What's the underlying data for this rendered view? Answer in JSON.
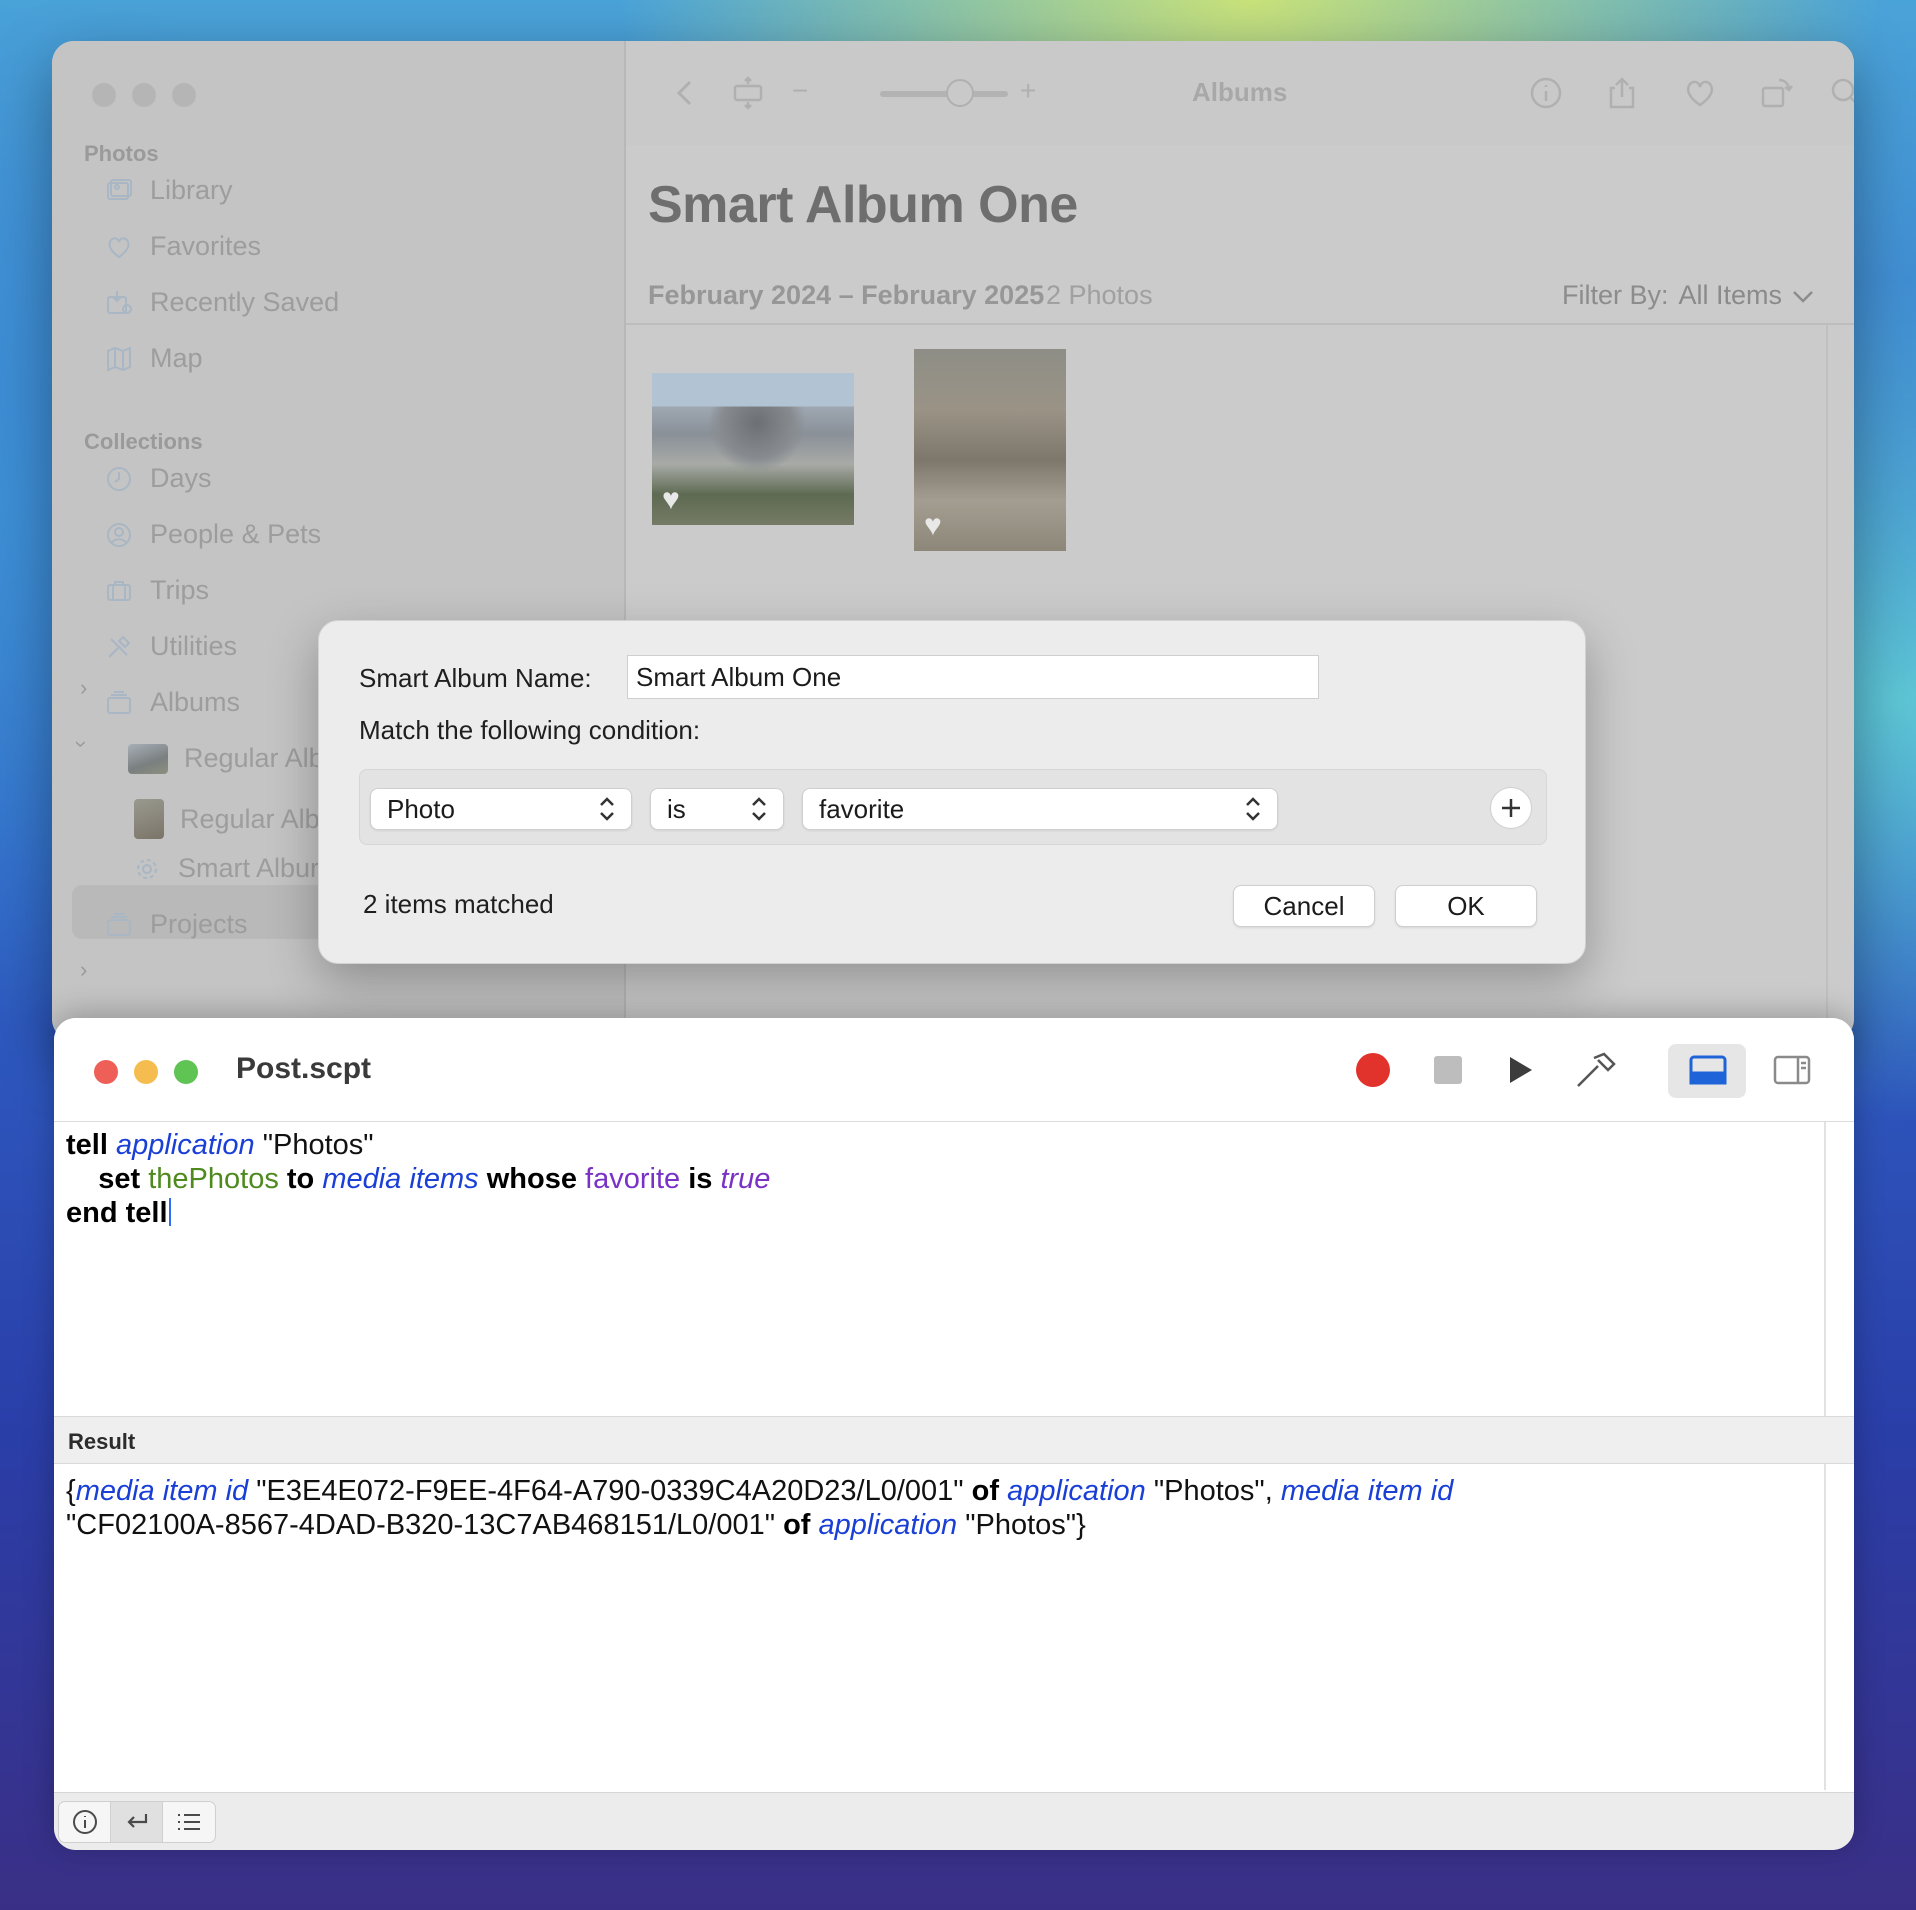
{
  "photos_window": {
    "toolbar_title": "Albums",
    "zoom_minus": "−",
    "zoom_plus": "+",
    "sidebar": {
      "section_photos": "Photos",
      "library": "Library",
      "favorites": "Favorites",
      "recently_saved": "Recently Saved",
      "map": "Map",
      "section_collections": "Collections",
      "days": "Days",
      "people_pets": "People & Pets",
      "trips": "Trips",
      "utilities": "Utilities",
      "albums": "Albums",
      "regular_album_1": "Regular Alb",
      "regular_album_2": "Regular Alb",
      "smart_album": "Smart Albur",
      "projects": "Projects"
    },
    "album": {
      "title": "Smart Album One",
      "date_range": "February 2024 – February 2025",
      "count": "2 Photos",
      "filter_label": "Filter By:",
      "filter_value": "All Items"
    }
  },
  "dialog": {
    "name_label": "Smart Album Name:",
    "name_value": "Smart Album One",
    "match_label": "Match the following condition:",
    "condition": {
      "field": "Photo",
      "operator": "is",
      "value": "favorite"
    },
    "matched": "2 items matched",
    "cancel": "Cancel",
    "ok": "OK"
  },
  "script_editor": {
    "title": "Post.scpt",
    "code": {
      "line1": {
        "kw": "tell",
        "cls": "application",
        "str": "\"Photos\""
      },
      "line2": {
        "kw1": "set",
        "var": "thePhotos",
        "kw2": "to",
        "cls": "media items",
        "kw3": "whose",
        "prop": "favorite",
        "kw4": "is",
        "bool": "true"
      },
      "line3": {
        "kw": "end tell"
      }
    },
    "result_header": "Result",
    "result": {
      "open": "{",
      "cls1": "media item id",
      "id1": "\"E3E4E072-F9EE-4F64-A790-0339C4A20D23/L0/001\"",
      "of1": "of",
      "app1": "application",
      "str1": "\"Photos\",",
      "cls2": "media item id",
      "id2": "\"CF02100A-8567-4DAD-B320-13C7AB468151/L0/001\"",
      "of2": "of",
      "app2": "application",
      "str2": "\"Photos\"}"
    }
  }
}
